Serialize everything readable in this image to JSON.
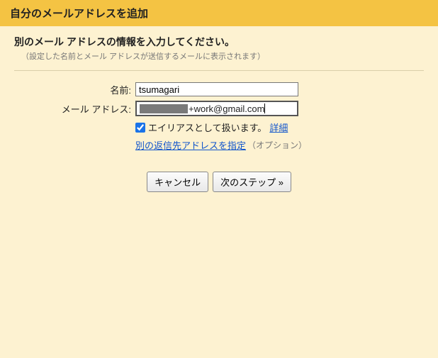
{
  "header": {
    "title": "自分のメールアドレスを追加"
  },
  "instruction": {
    "main": "別のメール アドレスの情報を入力してください。",
    "sub": "（設定した名前とメール アドレスが送信するメールに表示されます）"
  },
  "form": {
    "name": {
      "label": "名前:",
      "value": "tsumagari"
    },
    "email": {
      "label": "メール アドレス:",
      "value_suffix": "+work@gmail.com"
    },
    "alias": {
      "checked": true,
      "label": "エイリアスとして扱います。",
      "detail_link": "詳細"
    },
    "reply_to": {
      "link": "別の返信先アドレスを指定",
      "note": "（オプション）"
    }
  },
  "buttons": {
    "cancel": "キャンセル",
    "next": "次のステップ »"
  }
}
